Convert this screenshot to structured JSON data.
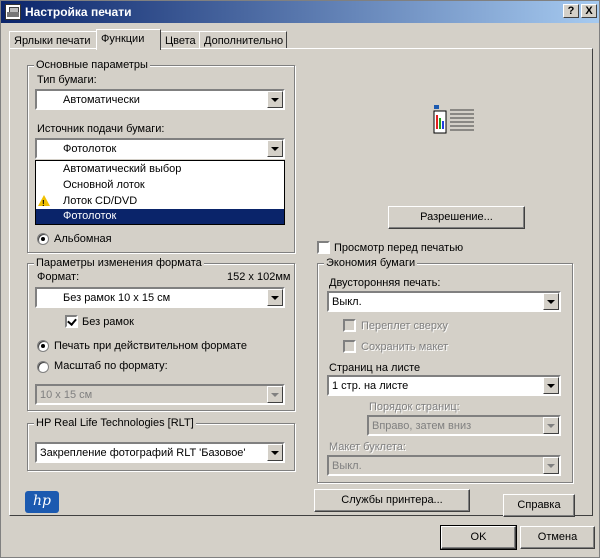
{
  "window": {
    "title": "Настройка печати",
    "help_button": "?",
    "close_button": "X"
  },
  "tabs": [
    {
      "label": "Ярлыки печати"
    },
    {
      "label": "Функции"
    },
    {
      "label": "Цвета"
    },
    {
      "label": "Дополнительно"
    }
  ],
  "basic": {
    "legend": "Основные параметры",
    "paper_type_label": "Тип бумаги:",
    "paper_type_value": "Автоматически",
    "paper_source_label": "Источник подачи бумаги:",
    "paper_source_value": "Фотолоток",
    "paper_source_options": [
      "Автоматический выбор",
      "Основной лоток",
      "Лоток CD/DVD",
      "Фотолоток"
    ],
    "orientation_landscape": "Альбомная"
  },
  "resize": {
    "legend": "Параметры изменения формата",
    "format_label": "Формат:",
    "format_size": "152 x 102мм",
    "format_value": "Без рамок 10 x 15 см",
    "borderless_label": "Без рамок",
    "print_actual_label": "Печать при действительном формате",
    "scale_label": "Масштаб по формату:",
    "scale_value": "10 x 15 см"
  },
  "rlt": {
    "legend": "HP Real Life Technologies [RLT]",
    "value": "Закрепление фотографий RLT 'Базовое'"
  },
  "resolution_button": "Разрешение...",
  "preview_label": "Просмотр перед печатью",
  "economy": {
    "legend": "Экономия бумаги",
    "duplex_label": "Двусторонняя печать:",
    "duplex_value": "Выкл.",
    "flip_top_label": "Переплет сверху",
    "keep_layout_label": "Сохранить макет",
    "pages_per_sheet_label": "Страниц на листе",
    "pages_per_sheet_value": "1 стр. на листе",
    "page_order_label": "Порядок страниц:",
    "page_order_value": "Вправо, затем вниз",
    "booklet_label": "Макет буклета:",
    "booklet_value": "Выкл."
  },
  "buttons": {
    "printer_services": "Службы принтера...",
    "help": "Справка",
    "ok": "OK",
    "cancel": "Отмена"
  },
  "logo_text": "hp",
  "colors": {
    "titlebar_start": "#0a246a",
    "titlebar_end": "#a6caf0",
    "selection": "#0a246a",
    "face": "#d4d0c8"
  }
}
